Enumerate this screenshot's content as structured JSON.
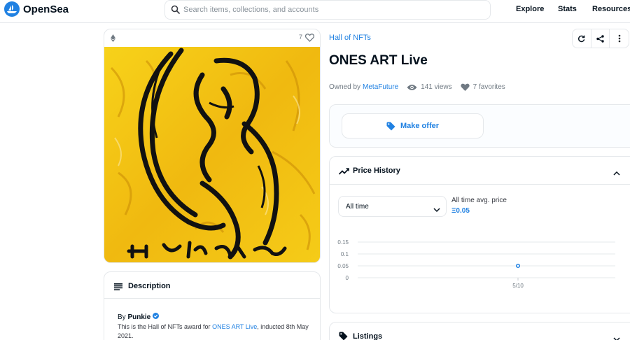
{
  "header": {
    "brand": "OpenSea",
    "search_placeholder": "Search items, collections, and accounts",
    "nav": [
      "Explore",
      "Stats",
      "Resources"
    ]
  },
  "item": {
    "favorites_count": "7",
    "collection": "Hall of NFTs",
    "title": "ONES ART Live",
    "owned_by_label": "Owned by",
    "owner": "MetaFuture",
    "views": "141 views",
    "favorites": "7 favorites"
  },
  "offer": {
    "make_offer_label": "Make offer"
  },
  "price_history": {
    "title": "Price History",
    "range_selected": "All time",
    "avg_label": "All time avg. price",
    "avg_value": "Ξ0.05"
  },
  "chart_data": {
    "type": "scatter",
    "x": [
      "5/10"
    ],
    "y": [
      0.05
    ],
    "yticks": [
      "0.15",
      "0.1",
      "0.05",
      "0"
    ],
    "ylim": [
      0,
      0.15
    ],
    "grid": true
  },
  "listings": {
    "title": "Listings"
  },
  "description": {
    "title": "Description",
    "by_prefix": "By",
    "creator": "Punkie",
    "text_before": "This is the Hall of NFTs award for",
    "text_link": "ONES ART Live",
    "text_after": ", inducted 8th May 2021."
  },
  "colors": {
    "accent": "#2081e2",
    "border": "#e5e8eb",
    "artwork_bg": "#f2c40f"
  }
}
